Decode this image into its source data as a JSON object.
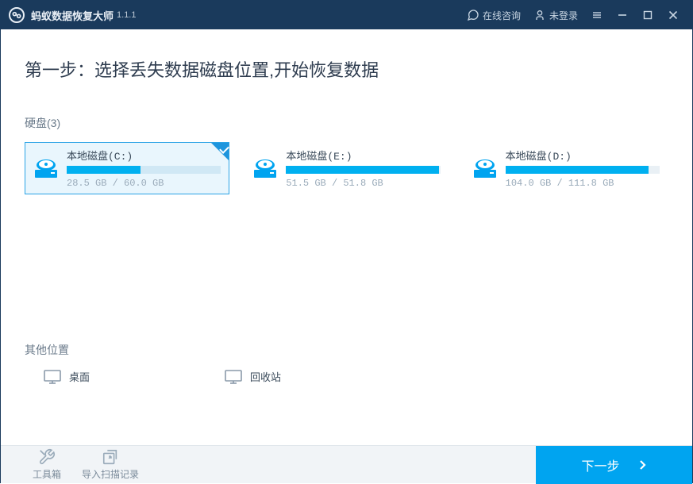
{
  "titlebar": {
    "app_name": "蚂蚁数据恢复大师",
    "version": "1.1.1",
    "consult": "在线咨询",
    "login": "未登录"
  },
  "main": {
    "step_title": "第一步：选择丢失数据磁盘位置,开始恢复数据",
    "disk_section_label": "硬盘(3)",
    "disks": [
      {
        "name": "本地磁盘(C:)",
        "used": "28.5 GB",
        "total": "60.0 GB",
        "fill_pct": 48,
        "selected": true
      },
      {
        "name": "本地磁盘(E:)",
        "used": "51.5 GB",
        "total": "51.8 GB",
        "fill_pct": 99,
        "selected": false
      },
      {
        "name": "本地磁盘(D:)",
        "used": "104.0 GB",
        "total": "111.8 GB",
        "fill_pct": 93,
        "selected": false
      }
    ],
    "other_section_label": "其他位置",
    "other_locations": [
      {
        "label": "桌面"
      },
      {
        "label": "回收站"
      }
    ]
  },
  "footer": {
    "toolbox": "工具箱",
    "import_scan": "导入扫描记录",
    "next": "下一步"
  },
  "colors": {
    "accent": "#00a4f0",
    "titlebar": "#1a3a5c"
  }
}
